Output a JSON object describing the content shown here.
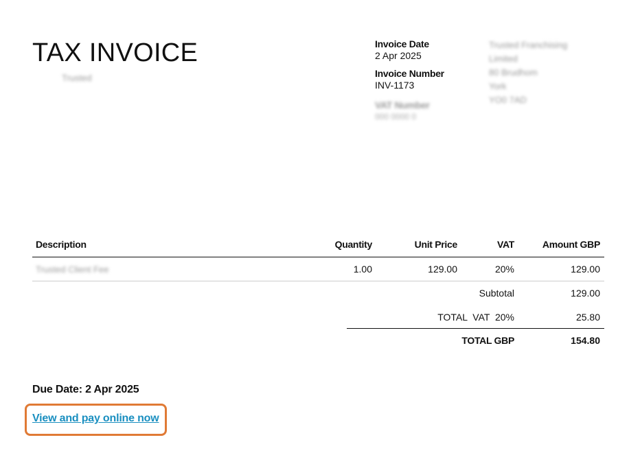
{
  "invoice": {
    "title": "TAX INVOICE",
    "client_name": "Trusted",
    "date_label": "Invoice Date",
    "date_value": "2 Apr 2025",
    "number_label": "Invoice Number",
    "number_value": "INV-1173",
    "vat_label": "VAT Number",
    "vat_value": "000 0000 0"
  },
  "supplier": {
    "lines": [
      "Trusted Franchising",
      "Limited",
      "80 Brudhom",
      "York",
      "YO0 7AD"
    ]
  },
  "table": {
    "headers": {
      "description": "Description",
      "quantity": "Quantity",
      "unit_price": "Unit Price",
      "vat": "VAT",
      "amount": "Amount GBP"
    },
    "rows": [
      {
        "description": "Trusted Client Fee",
        "quantity": "1.00",
        "unit_price": "129.00",
        "vat": "20%",
        "amount": "129.00"
      }
    ],
    "subtotal_label": "Subtotal",
    "subtotal_value": "129.00",
    "total_vat_label": "TOTAL  VAT  20%",
    "total_vat_value": "25.80",
    "total_label": "TOTAL GBP",
    "total_value": "154.80"
  },
  "due_date": "Due Date: 2 Apr 2025",
  "pay_link": "View and pay online now",
  "colors": {
    "link": "#1a8fc0",
    "highlight_border": "#e07a35",
    "rule": "#111111",
    "thin_rule": "#cccccc"
  }
}
